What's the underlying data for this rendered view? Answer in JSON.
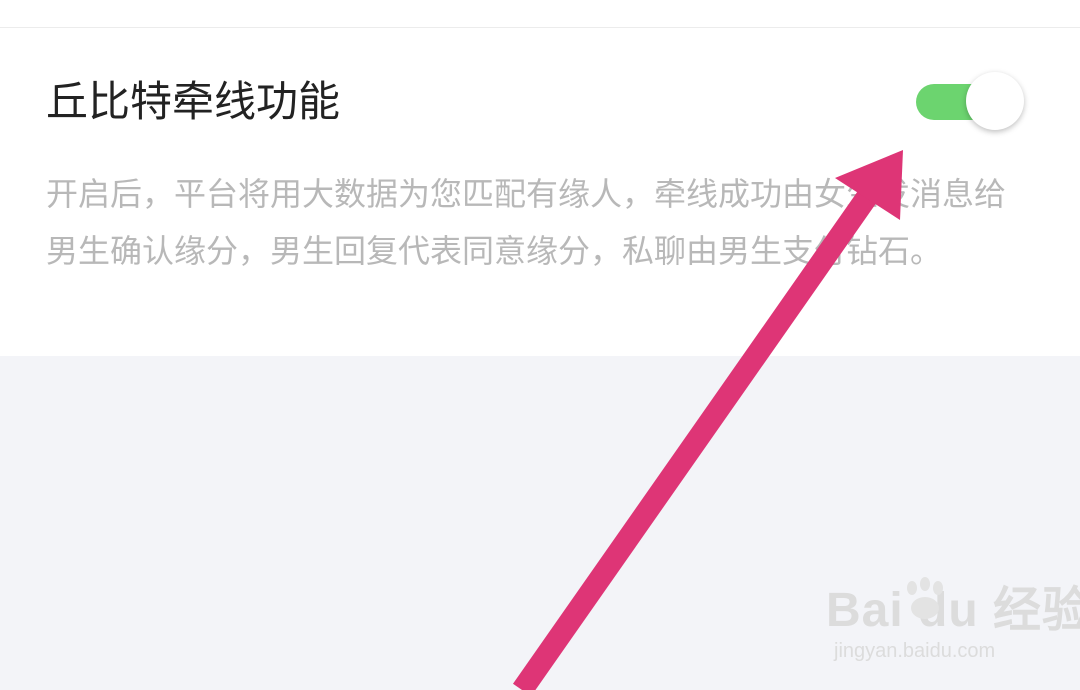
{
  "setting": {
    "title": "丘比特牵线功能",
    "enabled": true,
    "description": "开启后，平台将用大数据为您匹配有缘人，牵线成功由女生发消息给男生确认缘分，男生回复代表同意缘分，私聊由男生支付钻石。"
  },
  "colors": {
    "toggle_on": "#6cd46f",
    "background": "#f3f4f8",
    "description_text": "#b8b8b8",
    "arrow": "#de3576"
  },
  "watermark": {
    "logo_text": "Bai du 经验",
    "url": "jingyan.baidu.com"
  }
}
